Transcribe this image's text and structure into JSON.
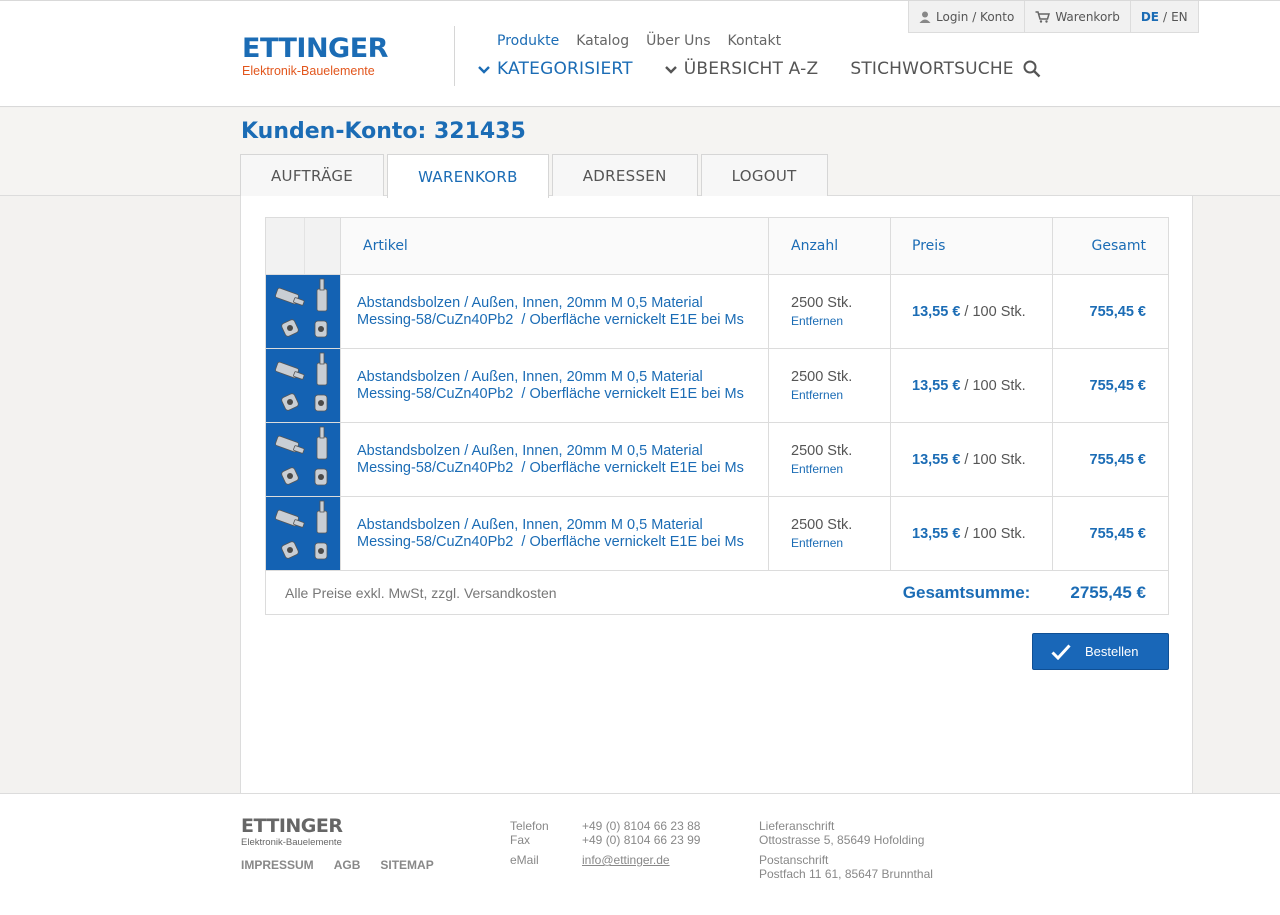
{
  "brand": {
    "name": "ETTINGER",
    "tagline": "Elektronik-Bauelemente",
    "color": "#1b6cb5",
    "accent": "#e2561d"
  },
  "utility_nav": {
    "login": "Login / Konto",
    "cart": "Warenkorb",
    "lang_de": "DE",
    "lang_sep": "/",
    "lang_en": "EN"
  },
  "top_nav": [
    "Produkte",
    "Katalog",
    "Über Uns",
    "Kontakt"
  ],
  "main_nav": {
    "categorized": "KATEGORISIERT",
    "overview": "ÜBERSICHT A-Z",
    "search": "STICHWORTSUCHE"
  },
  "account": {
    "title": "Kunden-Konto: 321435",
    "tabs": [
      "AUFTRÄGE",
      "WARENKORB",
      "ADRESSEN",
      "LOGOUT"
    ],
    "active_tab": "WARENKORB"
  },
  "cart": {
    "headers": {
      "article": "Artikel",
      "quantity": "Anzahl",
      "price": "Preis",
      "total": "Gesamt"
    },
    "items": [
      {
        "title": "Abstandsbolzen / Außen, Innen, 20mm M 0,5 Material\nMessing-58/CuZn40Pb2  / Oberfläche vernickelt E1E bei Ms",
        "quantity": "2500 Stk.",
        "remove": "Entfernen",
        "price": "13,55 €",
        "price_unit": " / 100 Stk.",
        "total": "755,45 €"
      },
      {
        "title": "Abstandsbolzen / Außen, Innen, 20mm M 0,5 Material\nMessing-58/CuZn40Pb2  / Oberfläche vernickelt E1E bei Ms",
        "quantity": "2500 Stk.",
        "remove": "Entfernen",
        "price": "13,55 €",
        "price_unit": " / 100 Stk.",
        "total": "755,45 €"
      },
      {
        "title": "Abstandsbolzen / Außen, Innen, 20mm M 0,5 Material\nMessing-58/CuZn40Pb2  / Oberfläche vernickelt E1E bei Ms",
        "quantity": "2500 Stk.",
        "remove": "Entfernen",
        "price": "13,55 €",
        "price_unit": " / 100 Stk.",
        "total": "755,45 €"
      },
      {
        "title": "Abstandsbolzen / Außen, Innen, 20mm M 0,5 Material\nMessing-58/CuZn40Pb2  / Oberfläche vernickelt E1E bei Ms",
        "quantity": "2500 Stk.",
        "remove": "Entfernen",
        "price": "13,55 €",
        "price_unit": " / 100 Stk.",
        "total": "755,45 €"
      }
    ],
    "footnote": "Alle Preise exkl. MwSt,  zzgl. Versandkosten",
    "sum_label": "Gesamtsumme:",
    "sum_value": "2755,45 €",
    "order_button": "Bestellen"
  },
  "footer": {
    "logo": "ETTINGER",
    "logo_sub": "Elektronik-Bauelemente",
    "links": [
      "IMPRESSUM",
      "AGB",
      "SITEMAP"
    ],
    "phone_label": "Telefon",
    "phone": "+49 (0) 8104 66 23 88",
    "fax_label": "Fax",
    "fax": "+49 (0) 8104 66 23 99",
    "email_label": "eMail",
    "email": "info@ettinger.de",
    "delivery_label": "Lieferanschrift",
    "delivery_address": "Ottostrasse 5, 85649 Hofolding",
    "postal_label": "Postanschrift",
    "postal_address": "Postfach 11 61, 85647 Brunnthal"
  }
}
